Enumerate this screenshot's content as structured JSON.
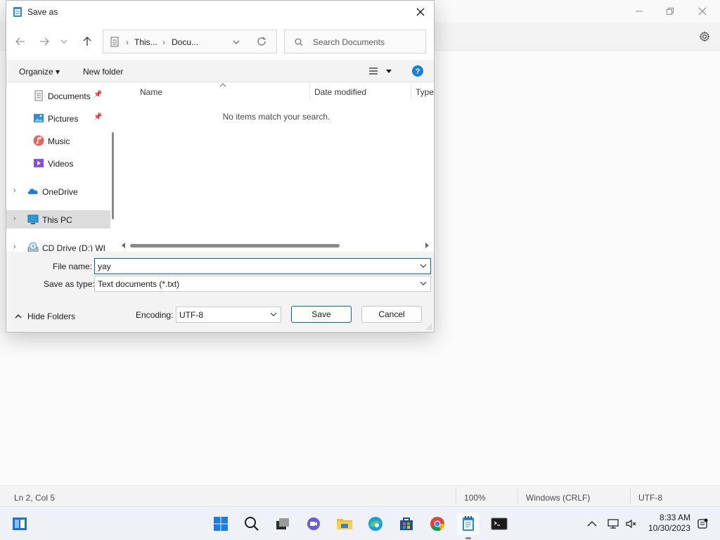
{
  "notepad": {
    "status": {
      "position": "Ln 2, Col 5",
      "zoom": "100%",
      "line_ending": "Windows (CRLF)",
      "encoding": "UTF-8"
    }
  },
  "dialog": {
    "title": "Save as",
    "breadcrumb": [
      "This...",
      "Docu..."
    ],
    "search_placeholder": "Search Documents",
    "commands": {
      "organize": "Organize",
      "new_folder": "New folder"
    },
    "nav_items": [
      {
        "label": "Documents",
        "icon": "documents-icon",
        "pinned": true
      },
      {
        "label": "Pictures",
        "icon": "pictures-icon",
        "pinned": true
      },
      {
        "label": "Music",
        "icon": "music-icon",
        "pinned": false
      },
      {
        "label": "Videos",
        "icon": "videos-icon",
        "pinned": false
      },
      {
        "label": "OneDrive",
        "icon": "onedrive-icon",
        "expandable": true
      },
      {
        "label": "This PC",
        "icon": "this-pc-icon",
        "expandable": true,
        "selected": true
      },
      {
        "label": "CD Drive (D:) WI",
        "icon": "cd-drive-icon",
        "expandable": true
      }
    ],
    "columns": [
      "Name",
      "Date modified",
      "Type"
    ],
    "empty_message": "No items match your search.",
    "file_name_label": "File name:",
    "file_name_value": "yay",
    "save_type_label": "Save as type:",
    "save_type_value": "Text documents (*.txt)",
    "encoding_label": "Encoding:",
    "encoding_value": "UTF-8",
    "save_button": "Save",
    "cancel_button": "Cancel",
    "hide_folders": "Hide Folders"
  },
  "taskbar": {
    "time": "8:33 AM",
    "date": "10/30/2023"
  },
  "colors": {
    "accent": "#0067c0",
    "selection": "#dcdcdc"
  }
}
